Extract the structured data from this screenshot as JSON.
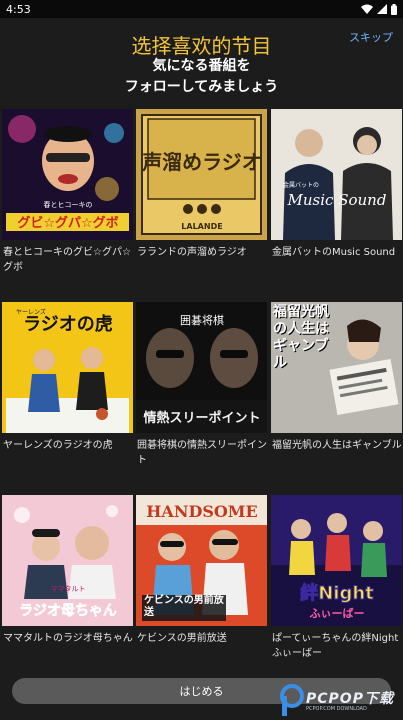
{
  "status_bar": {
    "time": "4:53"
  },
  "header": {
    "title": "选择喜欢的节目",
    "subtitle_line1": "気になる番組を",
    "subtitle_line2": "フォローしてみましょう",
    "skip_label": "スキップ"
  },
  "programs": [
    {
      "label": "春とヒコーキのグビ☆グパ☆グボ",
      "art_text": "グビ☆グパ☆グボ",
      "art_sub": "春とヒコーキの"
    },
    {
      "label": "ラランドの声溜めラジオ",
      "art_text": "声溜めラジオ",
      "art_sub": "LALANDE"
    },
    {
      "label": "金属バットのMusic Sound",
      "art_text": "Music Sound",
      "art_sub": "金属バットの"
    },
    {
      "label": "ヤーレンズのラジオの虎",
      "art_text": "ラジオの虎",
      "art_sub": "ヤーレンズ"
    },
    {
      "label": "囲碁将棋の情熱スリーポイント",
      "art_text": "情熱スリーポイント",
      "art_sub": "囲碁将棋"
    },
    {
      "label": "福留光帆の人生はギャンブル",
      "art_text": "福留光帆の人生はギャンブル",
      "art_sub": ""
    },
    {
      "label": "ママタルトのラジオ母ちゃん",
      "art_text": "ラジオ母ちゃん",
      "art_sub": "ママタルト"
    },
    {
      "label": "ケビンスの男前放送",
      "art_text": "ケビンスの男前放送",
      "art_sub": "HANDSOME"
    },
    {
      "label": "ぱーてぃーちゃんの絆Nightふぃーばー",
      "art_text": "絆Night",
      "art_sub": "ふぃーばー"
    }
  ],
  "start_button": {
    "label": "はじめる"
  },
  "watermark": {
    "text": "PCPOP下载",
    "sub": "PCPOP.COM DOWNLOAD"
  },
  "colors": {
    "title": "#f3c43a",
    "skip": "#6fb4ff",
    "background": "#1c1c1c"
  }
}
